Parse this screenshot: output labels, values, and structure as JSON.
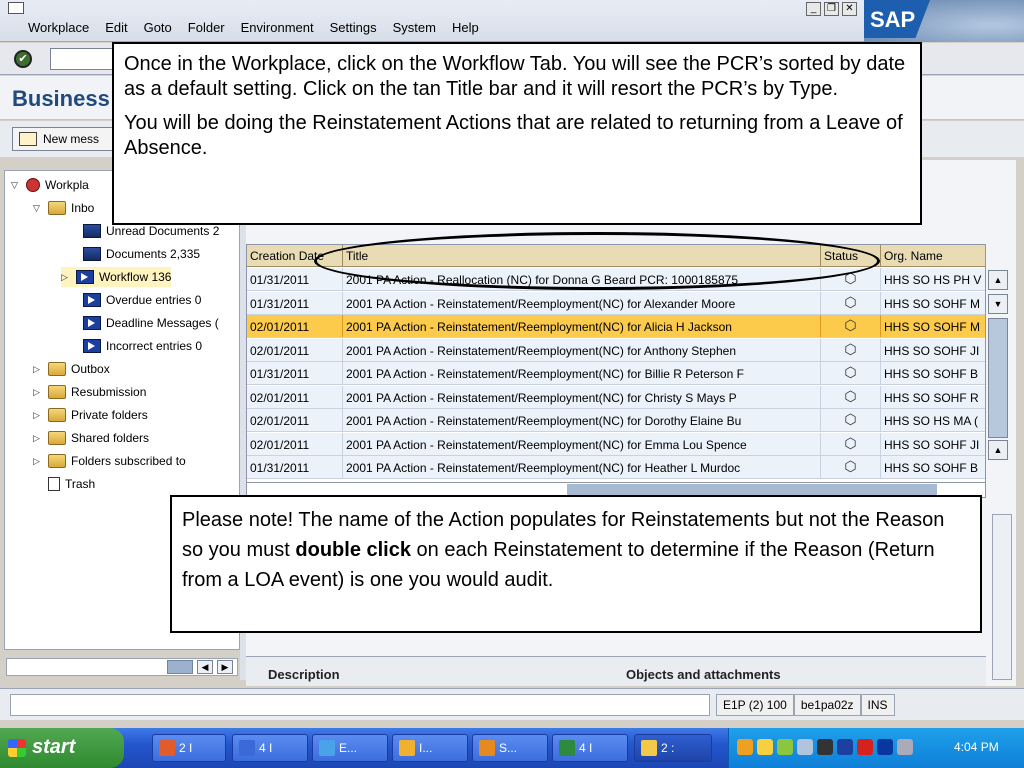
{
  "menubar": {
    "items": [
      "Workplace",
      "Edit",
      "Goto",
      "Folder",
      "Environment",
      "Settings",
      "System",
      "Help"
    ],
    "logo_text": "SAP"
  },
  "titlebar": {
    "title": "Business"
  },
  "apptoolbar": {
    "new_message_label": "New mess"
  },
  "tree": {
    "items": [
      {
        "label": "Workpla",
        "level": 0,
        "icon": "workplace-icon",
        "expander": "▽"
      },
      {
        "label": "Inbo",
        "level": 1,
        "icon": "folder-icon",
        "expander": "▽"
      },
      {
        "label": "Unread Documents 2",
        "level": 2,
        "icon": "document-icon",
        "expander": ""
      },
      {
        "label": "Documents 2,335",
        "level": 2,
        "icon": "document-icon",
        "expander": ""
      },
      {
        "label": "Workflow 136",
        "level": 2,
        "icon": "workflow-icon",
        "expander": "▷"
      },
      {
        "label": "Overdue entries 0",
        "level": 2,
        "icon": "workflow-icon",
        "expander": ""
      },
      {
        "label": "Deadline Messages (",
        "level": 2,
        "icon": "workflow-icon",
        "expander": ""
      },
      {
        "label": "Incorrect entries 0",
        "level": 2,
        "icon": "workflow-icon",
        "expander": ""
      },
      {
        "label": "Outbox",
        "level": 1,
        "icon": "folder-icon",
        "expander": "▷"
      },
      {
        "label": "Resubmission",
        "level": 1,
        "icon": "resubmission-icon",
        "expander": "▷"
      },
      {
        "label": "Private folders",
        "level": 1,
        "icon": "folder-icon",
        "expander": "▷"
      },
      {
        "label": "Shared folders",
        "level": 1,
        "icon": "folder-icon",
        "expander": "▷"
      },
      {
        "label": "Folders subscribed to",
        "level": 1,
        "icon": "folder-icon",
        "expander": "▷"
      },
      {
        "label": "Trash",
        "level": 1,
        "icon": "trash-icon",
        "expander": ""
      }
    ]
  },
  "workflow": {
    "title": "Workflow 136",
    "columns": [
      "Creation Date",
      "Title",
      "Status",
      "Org. Name"
    ],
    "rows": [
      {
        "date": "01/31/2011",
        "title": "2001 PA Action - Reallocation (NC) for Donna G Beard  PCR: 1000185875",
        "org": "HHS SO HS PH V",
        "selected": false
      },
      {
        "date": "01/31/2011",
        "title": "2001 PA Action - Reinstatement/Reemployment(NC) for Alexander Moore",
        "org": "HHS SO SOHF M",
        "selected": false
      },
      {
        "date": "02/01/2011",
        "title": "2001 PA Action - Reinstatement/Reemployment(NC) for Alicia H Jackson",
        "org": "HHS SO SOHF M",
        "selected": true
      },
      {
        "date": "02/01/2011",
        "title": "2001 PA Action - Reinstatement/Reemployment(NC) for Anthony Stephen",
        "org": "HHS SO SOHF JI",
        "selected": false
      },
      {
        "date": "01/31/2011",
        "title": "2001 PA Action - Reinstatement/Reemployment(NC) for Billie R Peterson  F",
        "org": "HHS SO SOHF B",
        "selected": false
      },
      {
        "date": "02/01/2011",
        "title": "2001 PA Action - Reinstatement/Reemployment(NC) for Christy S Mays  P",
        "org": "HHS SO SOHF R",
        "selected": false
      },
      {
        "date": "02/01/2011",
        "title": "2001 PA Action - Reinstatement/Reemployment(NC) for Dorothy Elaine Bu",
        "org": "HHS SO HS MA (",
        "selected": false
      },
      {
        "date": "02/01/2011",
        "title": "2001 PA Action - Reinstatement/Reemployment(NC) for Emma Lou Spence",
        "org": "HHS SO SOHF JI",
        "selected": false
      },
      {
        "date": "01/31/2011",
        "title": "2001 PA Action - Reinstatement/Reemployment(NC) for Heather L Murdoc",
        "org": "HHS SO SOHF B",
        "selected": false
      }
    ]
  },
  "bottom_panel": {
    "description_label": "Description",
    "objects_label": "Objects and attachments"
  },
  "statusbar": {
    "system": "E1P (2) 100",
    "server": "be1pa02z",
    "mode": "INS"
  },
  "taskbar": {
    "start_label": "start",
    "tasks": [
      "2 I",
      "4 I",
      "E...",
      "I...",
      "S...",
      "4 I",
      "2 :"
    ],
    "clock": "4:04 PM"
  },
  "callouts": {
    "top_p1": "Once in the Workplace, click on the Workflow Tab.  You will see the PCR’s sorted by date as a default setting. Click on the tan Title bar and it will resort the PCR’s by Type.",
    "top_p2": "You will be doing the Reinstatement Actions that are related to returning from a Leave of Absence.",
    "bottom_before": "Please note!  The name of the Action populates for Reinstatements but not the Reason so you must ",
    "bottom_bold": "double click",
    "bottom_after": " on each Reinstatement to determine if the Reason (Return from a LOA event) is one you would audit."
  },
  "colors": {
    "accent": "#204a7c",
    "selected_row": "#fdcb4c",
    "header_tan": "#e9dcb4",
    "row_bg": "#ebf2fa"
  }
}
